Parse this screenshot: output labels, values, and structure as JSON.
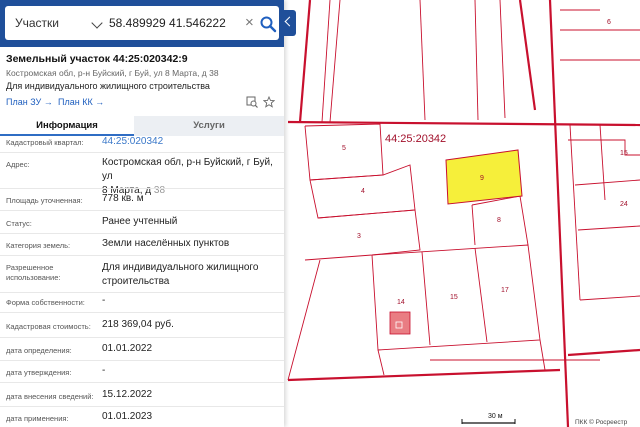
{
  "search": {
    "type": "Участки",
    "value": "58.489929 41.546222",
    "clear_glyph": "×"
  },
  "parcel": {
    "title": "Земельный участок 44:25:020342:9",
    "address_short": "Костромская обл, р-н Буйский, г Буй, ул 8 Марта, д 38",
    "use_short": "Для индивидуального жилищного строительства",
    "plan_zu": "План ЗУ →",
    "plan_kk": "План КК →"
  },
  "tabs": {
    "info": "Информация",
    "services": "Услуги"
  },
  "rows": {
    "quarter_label": "Кадастровый квартал:",
    "quarter_value": "44:25:020342",
    "address_label": "Адрес:",
    "address_line1": "Костромская обл, р-н Буйский, г Буй, ул",
    "address_line2": "8 Марта, д",
    "address_num": "38",
    "area_label": "Площадь уточненная:",
    "area_value": "778 кв. м",
    "status_label": "Статус:",
    "status_value": "Ранее учтенный",
    "category_label": "Категория земель:",
    "category_value": "Земли населённых пунктов",
    "permitted_label1": "Разрешенное",
    "permitted_label2": "использование:",
    "permitted_value1": "Для индивидуального жилищного",
    "permitted_value2": "строительства",
    "ownership_label": "Форма собственности:",
    "ownership_value": "-",
    "cost_label": "Кадастровая стоимость:",
    "cost_value": "218 369,04 руб.",
    "def_date_label": "дата определения:",
    "def_date_value": "01.01.2022",
    "appr_date_label": "дата утверждения:",
    "appr_date_value": "-",
    "entry_date_label": "дата внесения сведений:",
    "entry_date_value": "15.12.2022",
    "apply_date_label": "дата применения:",
    "apply_date_value": "01.01.2023"
  },
  "map": {
    "quarter_label": "44:25:20342",
    "parcels": [
      "5",
      "4",
      "3",
      "9",
      "8",
      "14",
      "15",
      "17",
      "6",
      "15",
      "24"
    ],
    "scale": "30 м",
    "credit": "ПКК © Росреестр",
    "highlight_color": "#f6ef3a",
    "border_color": "#c8102e"
  }
}
